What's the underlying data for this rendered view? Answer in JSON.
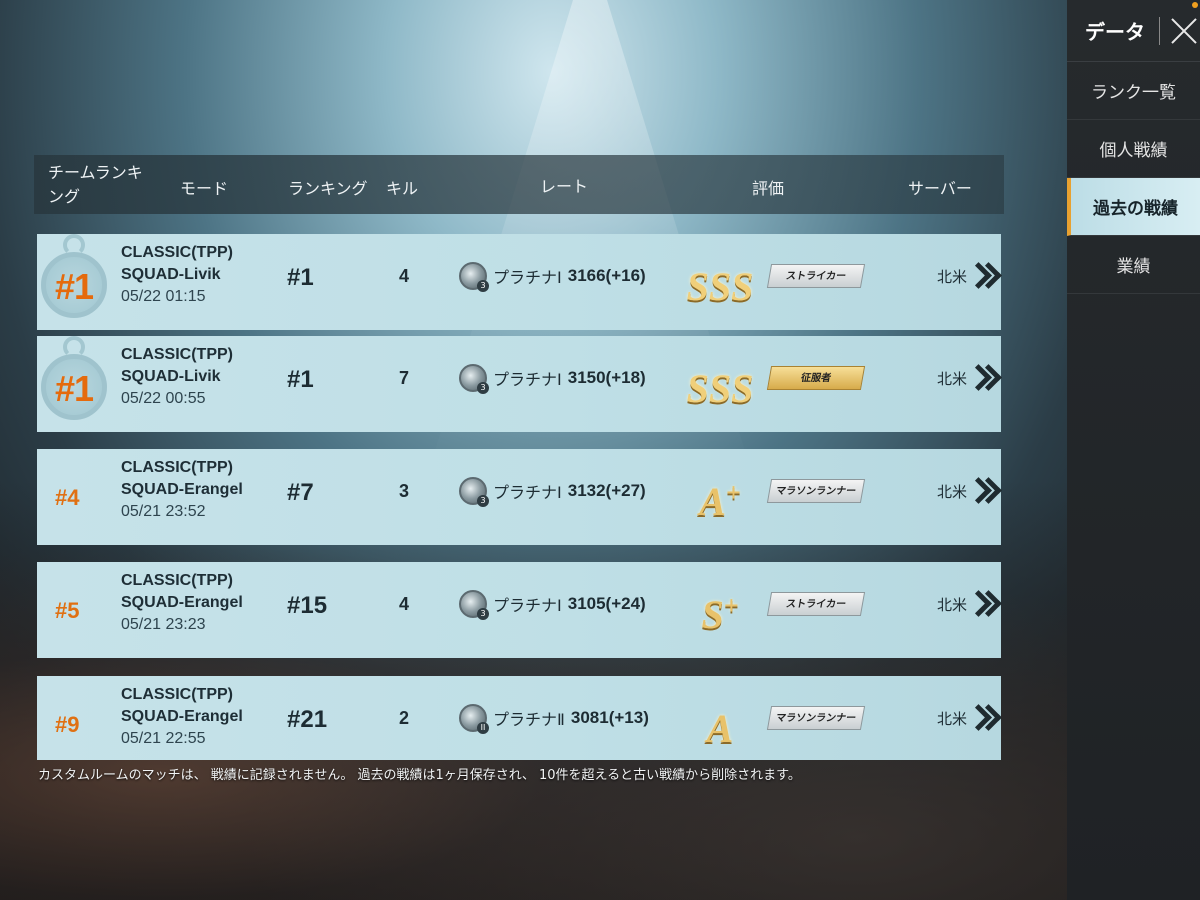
{
  "sidebar": {
    "title": "データ",
    "items": [
      {
        "label": "ランク一覧",
        "active": false
      },
      {
        "label": "個人戦績",
        "active": false
      },
      {
        "label": "過去の戦績",
        "active": true
      },
      {
        "label": "業績",
        "active": false
      }
    ]
  },
  "table": {
    "headers": {
      "team_rank": "チームランキング",
      "mode": "モード",
      "ranking": "ランキング",
      "kills": "キル",
      "rate": "レート",
      "evaluation": "評価",
      "server": "サーバー"
    },
    "rows": [
      {
        "team_rank": "#1",
        "medal": true,
        "mode": "CLASSIC(TPP)",
        "map": "SQUAD-Livik",
        "date": "05/22 01:15",
        "ranking": "#1",
        "kills": "4",
        "tier_icon": "platinum-tier-icon",
        "tier_level": "3",
        "tier": "プラチナⅠ",
        "score": "3166(+16)",
        "grade": "SSS",
        "grade_sup": "",
        "badge": "ストライカー",
        "badge_style": "silver",
        "server": "北米"
      },
      {
        "team_rank": "#1",
        "medal": true,
        "mode": "CLASSIC(TPP)",
        "map": "SQUAD-Livik",
        "date": "05/22 00:55",
        "ranking": "#1",
        "kills": "7",
        "tier_icon": "platinum-tier-icon",
        "tier_level": "3",
        "tier": "プラチナⅠ",
        "score": "3150(+18)",
        "grade": "SSS",
        "grade_sup": "",
        "badge": "征服者",
        "badge_style": "gold",
        "server": "北米"
      },
      {
        "team_rank": "#4",
        "medal": false,
        "mode": "CLASSIC(TPP)",
        "map": "SQUAD-Erangel",
        "date": "05/21 23:52",
        "ranking": "#7",
        "kills": "3",
        "tier_icon": "platinum-tier-icon",
        "tier_level": "3",
        "tier": "プラチナⅠ",
        "score": "3132(+27)",
        "grade": "A",
        "grade_sup": "+",
        "badge": "マラソンランナー",
        "badge_style": "silver",
        "server": "北米"
      },
      {
        "team_rank": "#5",
        "medal": false,
        "mode": "CLASSIC(TPP)",
        "map": "SQUAD-Erangel",
        "date": "05/21 23:23",
        "ranking": "#15",
        "kills": "4",
        "tier_icon": "platinum-tier-icon",
        "tier_level": "3",
        "tier": "プラチナⅠ",
        "score": "3105(+24)",
        "grade": "S",
        "grade_sup": "+",
        "badge": "ストライカー",
        "badge_style": "silver",
        "server": "北米"
      },
      {
        "team_rank": "#9",
        "medal": false,
        "mode": "CLASSIC(TPP)",
        "map": "SQUAD-Erangel",
        "date": "05/21 22:55",
        "ranking": "#21",
        "kills": "2",
        "tier_icon": "platinum-tier-icon",
        "tier_level": "II",
        "tier": "プラチナⅡ",
        "score": "3081(+13)",
        "grade": "A",
        "grade_sup": "",
        "badge": "マラソンランナー",
        "badge_style": "silver",
        "server": "北米"
      }
    ]
  },
  "footer_note": "カスタムルームのマッチは、 戦績に記録されません。 過去の戦績は1ヶ月保存され、 10件を超えると古い戦績から削除されます。",
  "colors": {
    "accent_orange": "#e56a0c",
    "row_bg": "#c6e2e9",
    "active_tab": "#d8eef3"
  }
}
